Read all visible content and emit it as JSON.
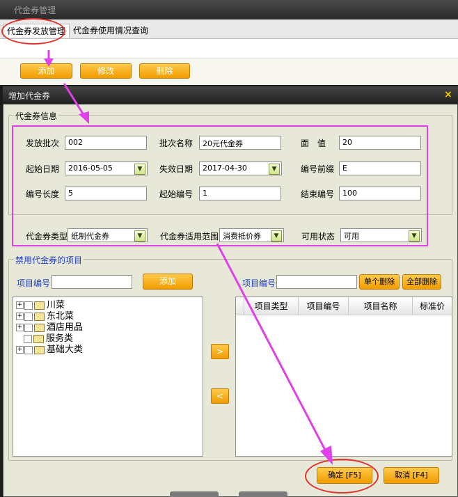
{
  "window": {
    "title": "代金券管理"
  },
  "tabs": [
    {
      "label": "代金券发放管理"
    },
    {
      "label": "代金券使用情况查询"
    }
  ],
  "toolbar": {
    "add_label": "添加",
    "edit_label": "修改",
    "delete_label": "删除"
  },
  "dialog": {
    "title": "增加代金券",
    "close_symbol": "×",
    "info_group": "代金券信息",
    "fields": {
      "batch_no": {
        "label": "发放批次",
        "value": "002"
      },
      "batch_name": {
        "label": "批次名称",
        "value": "20元代金券"
      },
      "face_value": {
        "label": "面　值",
        "value": "20"
      },
      "start_date": {
        "label": "起始日期",
        "value": "2016-05-05"
      },
      "end_date": {
        "label": "失效日期",
        "value": "2017-04-30"
      },
      "prefix": {
        "label": "编号前缀",
        "value": "E"
      },
      "code_length": {
        "label": "编号长度",
        "value": "5"
      },
      "start_no": {
        "label": "起始编号",
        "value": "1"
      },
      "end_no": {
        "label": "结束编号",
        "value": "100"
      },
      "voucher_type": {
        "label": "代金券类型",
        "value": "纸制代金券"
      },
      "scope": {
        "label": "代金券适用范围",
        "value": "消费抵价券"
      },
      "status": {
        "label": "可用状态",
        "value": "可用"
      }
    },
    "ban_group": "禁用代金券的项目",
    "left_item_label": "项目编号",
    "left_add_label": "添加",
    "right_item_label": "项目编号",
    "single_delete_label": "单个删除",
    "all_delete_label": "全部删除",
    "tree": [
      "川菜",
      "东北菜",
      "酒店用品",
      "服务类",
      "基础大类"
    ],
    "grid_columns": [
      "项目类型",
      "项目编号",
      "项目名称",
      "标准价"
    ],
    "move_right_symbol": ">",
    "move_left_symbol": "<",
    "ok_label": "确定 [F5]",
    "cancel_label": "取消 [F4]"
  },
  "annotation_colors": {
    "pink": "#e040e8",
    "red": "#e2342c"
  }
}
